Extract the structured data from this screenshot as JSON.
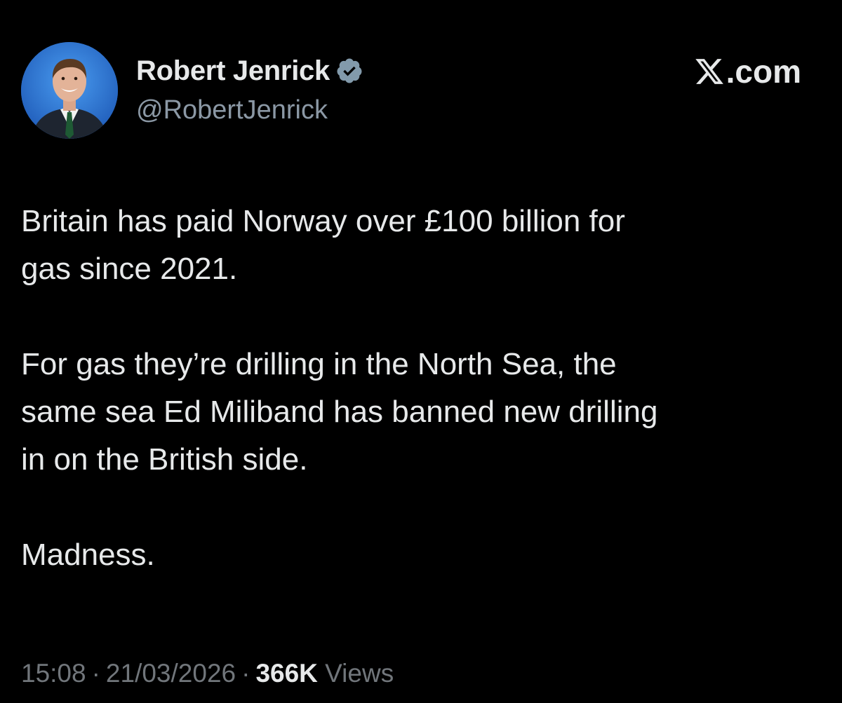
{
  "author": {
    "display_name": "Robert Jenrick",
    "handle": "@RobertJenrick",
    "verified_icon": "verified-badge",
    "verified_color": "#829aab"
  },
  "brand": {
    "logo_icon": "x-logo",
    "text": ".com"
  },
  "tweet": {
    "paragraphs": [
      [
        "Britain has paid Norway over £100 billion for",
        "gas since 2021."
      ],
      [
        "For gas they’re drilling in the North Sea, the",
        "same sea Ed Miliband has banned new drilling",
        "in on the British side."
      ],
      [
        "Madness."
      ]
    ]
  },
  "meta": {
    "time": "15:08",
    "separator": "·",
    "date": "21/03/2026",
    "views_count": "366K",
    "views_label": "Views"
  },
  "colors": {
    "background": "#000000",
    "text_primary": "#e7e9ea",
    "text_secondary": "#71767b"
  }
}
